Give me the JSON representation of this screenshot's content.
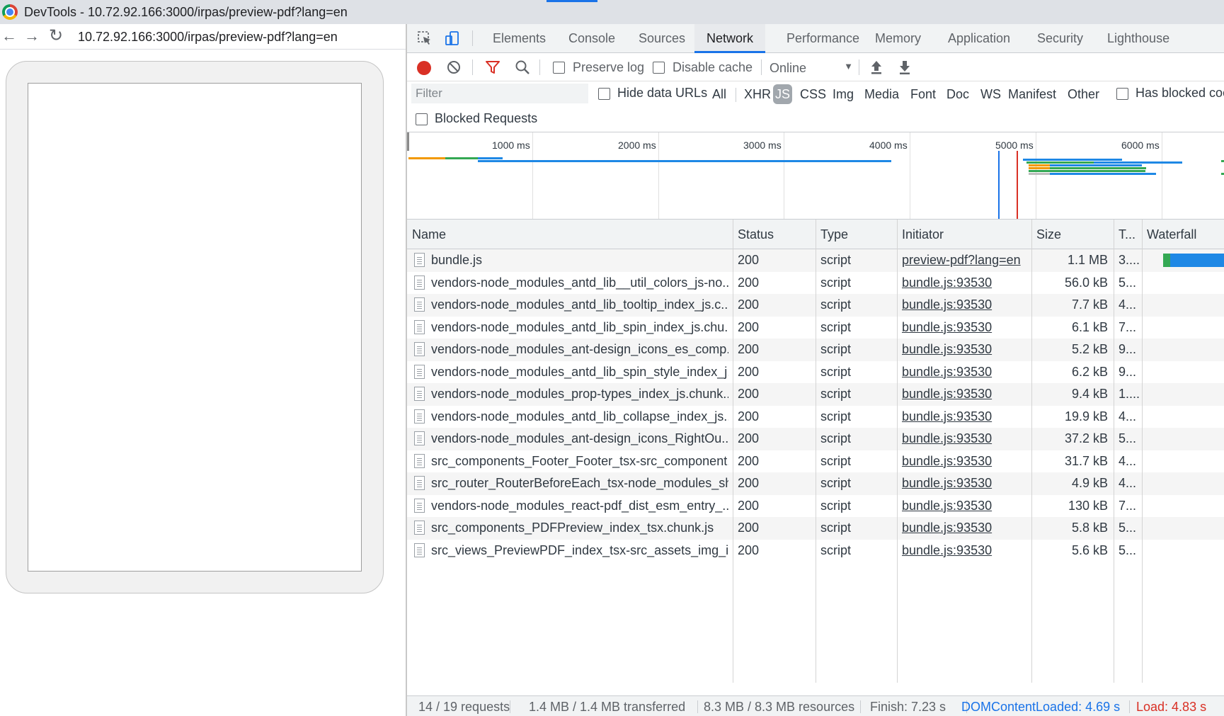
{
  "window": {
    "title": "DevTools - 10.72.92.166:3000/irpas/preview-pdf?lang=en"
  },
  "browser": {
    "url": "10.72.92.166:3000/irpas/preview-pdf?lang=en"
  },
  "devtools": {
    "tabs": [
      {
        "label": "Elements"
      },
      {
        "label": "Console"
      },
      {
        "label": "Sources"
      },
      {
        "label": "Network",
        "active": true
      },
      {
        "label": "Performance"
      },
      {
        "label": "Memory"
      },
      {
        "label": "Application"
      },
      {
        "label": "Security"
      },
      {
        "label": "Lighthouse"
      }
    ],
    "toolbar": {
      "preserve_log": "Preserve log",
      "disable_cache": "Disable cache",
      "throttle": "Online"
    },
    "filter": {
      "placeholder": "Filter",
      "hide_data_urls": "Hide data URLs",
      "types": [
        "All",
        "XHR",
        "JS",
        "CSS",
        "Img",
        "Media",
        "Font",
        "Doc",
        "WS",
        "Manifest",
        "Other"
      ],
      "active_type": "JS",
      "has_blocked_cookies": "Has blocked coo",
      "blocked_requests": "Blocked Requests"
    },
    "overview": {
      "ticks": [
        "1000 ms",
        "2000 ms",
        "3000 ms",
        "4000 ms",
        "5000 ms",
        "6000 ms"
      ]
    },
    "table": {
      "columns": [
        "Name",
        "Status",
        "Type",
        "Initiator",
        "Size",
        "T...",
        "Waterfall"
      ],
      "rows": [
        {
          "name": "bundle.js",
          "status": "200",
          "type": "script",
          "initiator": "preview-pdf?lang=en",
          "size": "1.1 MB",
          "time": "3...."
        },
        {
          "name": "vendors-node_modules_antd_lib__util_colors_js-no...",
          "status": "200",
          "type": "script",
          "initiator": "bundle.js:93530",
          "size": "56.0 kB",
          "time": "5..."
        },
        {
          "name": "vendors-node_modules_antd_lib_tooltip_index_js.c...",
          "status": "200",
          "type": "script",
          "initiator": "bundle.js:93530",
          "size": "7.7 kB",
          "time": "4..."
        },
        {
          "name": "vendors-node_modules_antd_lib_spin_index_js.chu...",
          "status": "200",
          "type": "script",
          "initiator": "bundle.js:93530",
          "size": "6.1 kB",
          "time": "7..."
        },
        {
          "name": "vendors-node_modules_ant-design_icons_es_comp...",
          "status": "200",
          "type": "script",
          "initiator": "bundle.js:93530",
          "size": "5.2 kB",
          "time": "9..."
        },
        {
          "name": "vendors-node_modules_antd_lib_spin_style_index_j...",
          "status": "200",
          "type": "script",
          "initiator": "bundle.js:93530",
          "size": "6.2 kB",
          "time": "9..."
        },
        {
          "name": "vendors-node_modules_prop-types_index_js.chunk...",
          "status": "200",
          "type": "script",
          "initiator": "bundle.js:93530",
          "size": "9.4 kB",
          "time": "1...."
        },
        {
          "name": "vendors-node_modules_antd_lib_collapse_index_js...",
          "status": "200",
          "type": "script",
          "initiator": "bundle.js:93530",
          "size": "19.9 kB",
          "time": "4..."
        },
        {
          "name": "vendors-node_modules_ant-design_icons_RightOu...",
          "status": "200",
          "type": "script",
          "initiator": "bundle.js:93530",
          "size": "37.2 kB",
          "time": "5..."
        },
        {
          "name": "src_components_Footer_Footer_tsx-src_component...",
          "status": "200",
          "type": "script",
          "initiator": "bundle.js:93530",
          "size": "31.7 kB",
          "time": "4..."
        },
        {
          "name": "src_router_RouterBeforeEach_tsx-node_modules_sh...",
          "status": "200",
          "type": "script",
          "initiator": "bundle.js:93530",
          "size": "4.9 kB",
          "time": "4..."
        },
        {
          "name": "vendors-node_modules_react-pdf_dist_esm_entry_...",
          "status": "200",
          "type": "script",
          "initiator": "bundle.js:93530",
          "size": "130 kB",
          "time": "7..."
        },
        {
          "name": "src_components_PDFPreview_index_tsx.chunk.js",
          "status": "200",
          "type": "script",
          "initiator": "bundle.js:93530",
          "size": "5.8 kB",
          "time": "5..."
        },
        {
          "name": "src_views_PreviewPDF_index_tsx-src_assets_img_ic...",
          "status": "200",
          "type": "script",
          "initiator": "bundle.js:93530",
          "size": "5.6 kB",
          "time": "5..."
        }
      ]
    },
    "status": {
      "requests": "14 / 19 requests",
      "transferred": "1.4 MB / 1.4 MB transferred",
      "resources": "8.3 MB / 8.3 MB resources",
      "finish": "Finish: 7.23 s",
      "dom_content_loaded": "DOMContentLoaded: 4.69 s",
      "load": "Load: 4.83 s"
    },
    "colors": {
      "dcl_line": "#1a73e8",
      "load_line": "#d93025",
      "accent": "#1a73e8"
    }
  }
}
